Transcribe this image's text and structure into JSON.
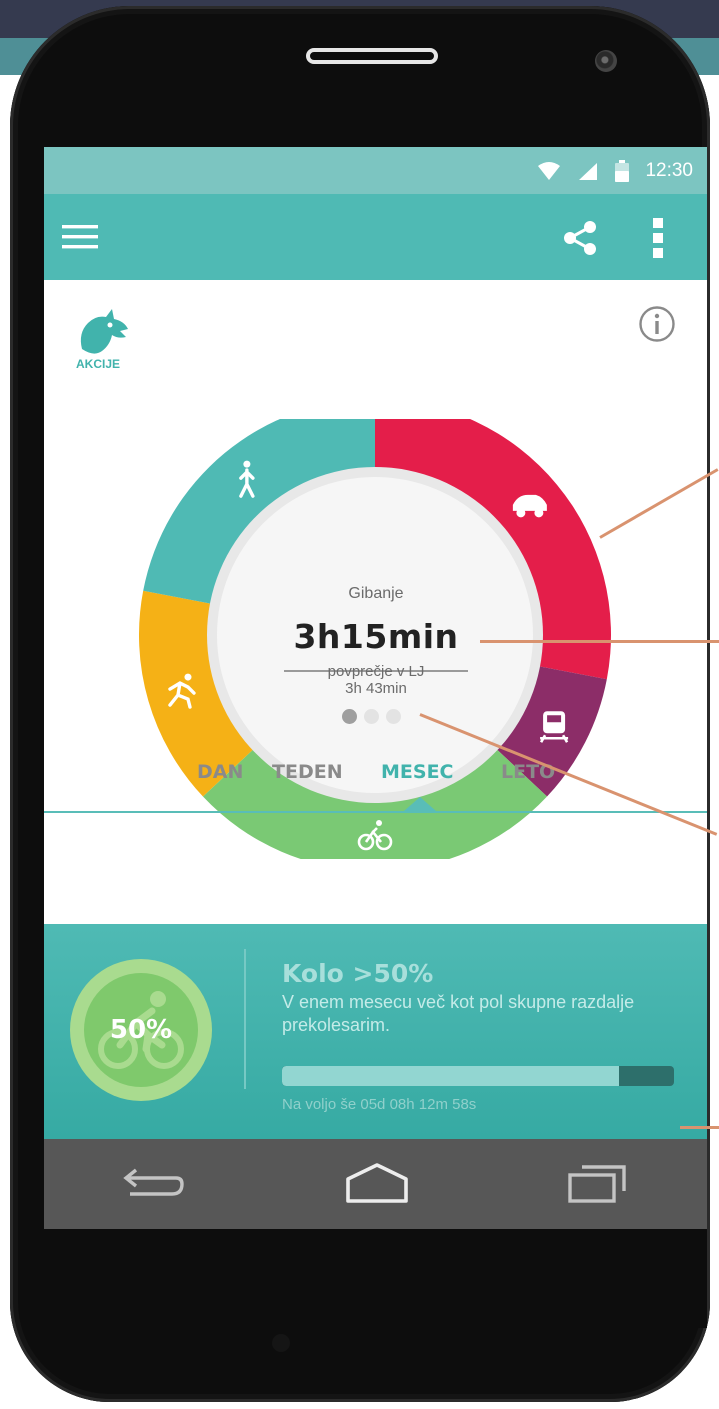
{
  "colors": {
    "accent": "#4fbab4",
    "car": "#e41e4a",
    "train": "#8c2d68",
    "bike": "#7ac974",
    "run": "#f5b116",
    "walk": "#4fbab4"
  },
  "status_bar": {
    "time": "12:30",
    "icons": [
      "wifi-icon",
      "signal-icon",
      "battery-icon"
    ]
  },
  "app_bar": {
    "icons": [
      "menu-icon",
      "share-icon",
      "more-vert-icon"
    ]
  },
  "header": {
    "logo_label": "AKCIJE",
    "info_icon": "info-icon"
  },
  "summary": {
    "title": "Gibanje",
    "value": "3h15min",
    "average_label": "povprečje v LJ",
    "average_value": "3h 43min",
    "page_count": 3,
    "active_page": 1
  },
  "chart_data": {
    "type": "pie",
    "style": "donut",
    "labels": [
      "avto",
      "vlak",
      "kolo",
      "tek",
      "hoja"
    ],
    "values": [
      28,
      9,
      26,
      15,
      22
    ],
    "icons": [
      "car-icon",
      "train-icon",
      "bike-icon",
      "run-icon",
      "walk-icon"
    ]
  },
  "period_tabs": [
    {
      "label": "DAN",
      "active": false
    },
    {
      "label": "TEDEN",
      "active": false
    },
    {
      "label": "MESEC",
      "active": true
    },
    {
      "label": "LETO",
      "active": false
    }
  ],
  "promo": {
    "badge_text": "50%",
    "title": "Kolo >50%",
    "description": "V enem mesecu več kot pol skupne razdalje prekolesarim.",
    "progress": 0.86,
    "timer": "Na voljo še 05d 08h 12m 58s"
  },
  "nav_bar": {
    "icons": [
      "back-icon",
      "home-icon",
      "recent-apps-icon"
    ]
  }
}
